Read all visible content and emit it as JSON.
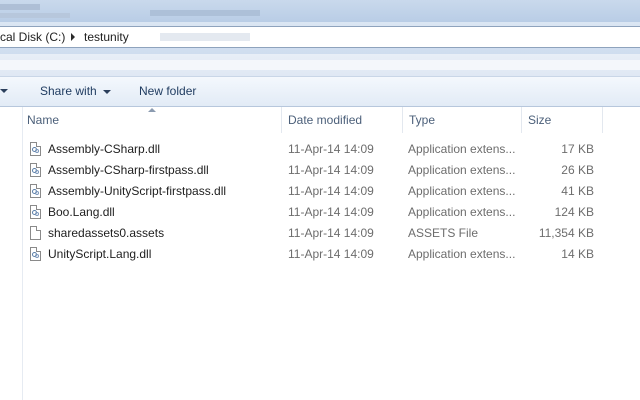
{
  "address": {
    "crumbs": [
      "cal Disk (C:)",
      "testunity"
    ]
  },
  "toolbar": {
    "share_with_label": "Share with",
    "new_folder_label": "New folder"
  },
  "columns": {
    "name": "Name",
    "date_modified": "Date modified",
    "type": "Type",
    "size": "Size"
  },
  "files": [
    {
      "name": "Assembly-CSharp.dll",
      "date": "11-Apr-14 14:09",
      "type": "Application extens...",
      "size": "17 KB",
      "icon": "dll-file-icon"
    },
    {
      "name": "Assembly-CSharp-firstpass.dll",
      "date": "11-Apr-14 14:09",
      "type": "Application extens...",
      "size": "26 KB",
      "icon": "dll-file-icon"
    },
    {
      "name": "Assembly-UnityScript-firstpass.dll",
      "date": "11-Apr-14 14:09",
      "type": "Application extens...",
      "size": "41 KB",
      "icon": "dll-file-icon"
    },
    {
      "name": "Boo.Lang.dll",
      "date": "11-Apr-14 14:09",
      "type": "Application extens...",
      "size": "124 KB",
      "icon": "dll-file-icon"
    },
    {
      "name": "sharedassets0.assets",
      "date": "11-Apr-14 14:09",
      "type": "ASSETS File",
      "size": "11,354 KB",
      "icon": "blank-file-icon"
    },
    {
      "name": "UnityScript.Lang.dll",
      "date": "11-Apr-14 14:09",
      "type": "Application extens...",
      "size": "14 KB",
      "icon": "dll-file-icon"
    }
  ],
  "colors": {
    "toolbar_text": "#1e3a5f",
    "header_text": "#4c607a",
    "secondary_text": "#6d6d6d"
  }
}
